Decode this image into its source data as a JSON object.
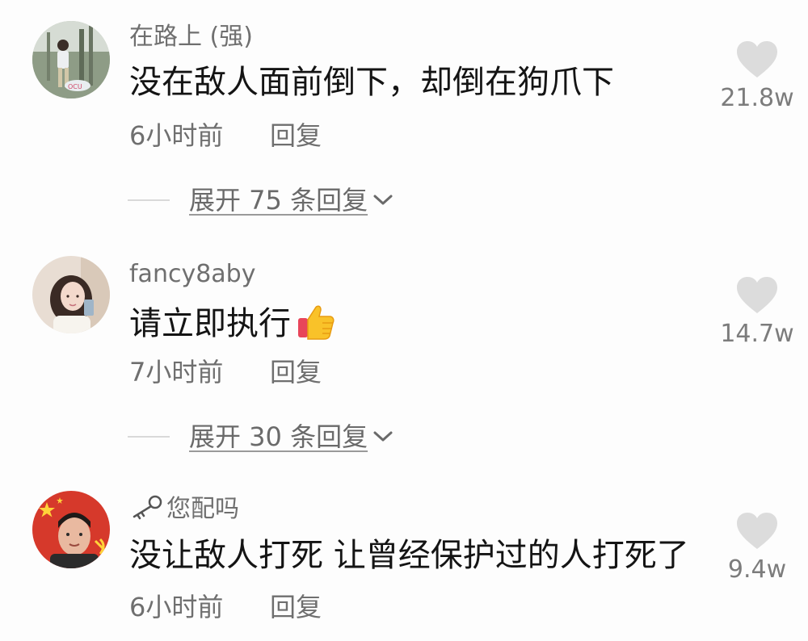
{
  "comments": [
    {
      "author": "在路上 (强)",
      "text": "没在敌人面前倒下，却倒在狗爪下",
      "time": "6小时前",
      "reply_label": "回复",
      "likes": "21.8w",
      "expand_label": "展开 75 条回复"
    },
    {
      "author": "fancy8aby",
      "text": "请立即执行",
      "emoji": "thumbs-up-icon",
      "time": "7小时前",
      "reply_label": "回复",
      "likes": "14.7w",
      "expand_label": "展开 30 条回复"
    },
    {
      "author_icon": "key-icon",
      "author": "您配吗",
      "text": "没让敌人打死 让曾经保护过的人打死了",
      "time": "6小时前",
      "reply_label": "回复",
      "likes": "9.4w"
    }
  ],
  "icons": {
    "like": "heart-icon",
    "expand": "chevron-down-icon"
  },
  "colors": {
    "heart": "#dcdcdc",
    "secondary_text": "#6f6f6f",
    "primary_text": "#141414"
  }
}
